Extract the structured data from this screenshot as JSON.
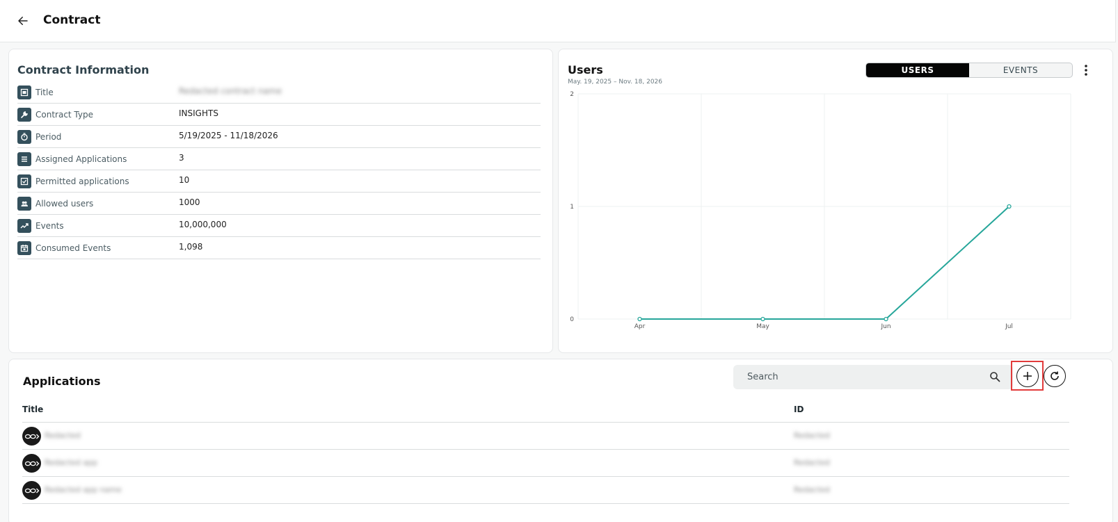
{
  "header": {
    "title": "Contract"
  },
  "contract_info": {
    "heading": "Contract Information",
    "rows": [
      {
        "label": "Title",
        "value": "Redacted contract name",
        "icon": "id-card-icon",
        "blurred": true
      },
      {
        "label": "Contract Type",
        "value": "INSIGHTS",
        "icon": "wrench-icon"
      },
      {
        "label": "Period",
        "value": "5/19/2025 - 11/18/2026",
        "icon": "timer-icon"
      },
      {
        "label": "Assigned Applications",
        "value": "3",
        "icon": "list-icon"
      },
      {
        "label": "Permitted applications",
        "value": "10",
        "icon": "check-square-icon"
      },
      {
        "label": "Allowed users",
        "value": "1000",
        "icon": "users-icon"
      },
      {
        "label": "Events",
        "value": "10,000,000",
        "icon": "trend-icon"
      },
      {
        "label": "Consumed Events",
        "value": "1,098",
        "icon": "calendar-icon"
      }
    ]
  },
  "chart_panel": {
    "title": "Users",
    "subtitle": "May. 19, 2025 – Nov. 18, 2026",
    "toggle": {
      "users_label": "USERS",
      "events_label": "EVENTS",
      "active": "USERS"
    }
  },
  "chart_data": {
    "type": "line",
    "title": "Users",
    "x": [
      "Apr",
      "May",
      "Jun",
      "Jul"
    ],
    "series": [
      {
        "values": [
          0,
          0,
          0,
          1
        ]
      }
    ],
    "ylim": [
      0,
      2
    ],
    "yticks": [
      "0",
      "1",
      "2"
    ],
    "xlabel": "",
    "ylabel": "",
    "grid": true,
    "color": "#26a69a"
  },
  "applications": {
    "heading": "Applications",
    "search_placeholder": "Search",
    "columns": {
      "title": "Title",
      "id": "ID"
    },
    "rows": [
      {
        "name": "Redacted",
        "id": "Redacted"
      },
      {
        "name": "Redacted app",
        "id": "Redacted"
      },
      {
        "name": "Redacted app name",
        "id": "Redacted"
      }
    ]
  },
  "colors": {
    "accent": "#26a69a",
    "icon_bg": "#34505c",
    "highlight": "#e23b3b"
  }
}
